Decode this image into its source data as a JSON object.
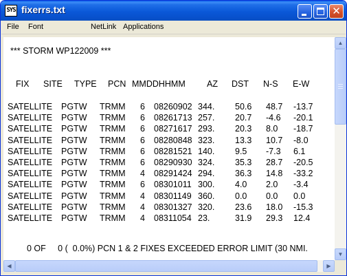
{
  "window": {
    "title": "fixerrs.txt",
    "app_icon_text": "SYS",
    "close_glyph": "✕"
  },
  "menu": [
    "File",
    "Font",
    "NetLink",
    "Applications"
  ],
  "storm_title": "*** STORM WP122009 ***",
  "columns": [
    "FIX",
    "SITE",
    "TYPE",
    "PCN",
    "MMDDHHMM",
    "AZ",
    "DST",
    "N-S",
    "E-W"
  ],
  "rows": [
    [
      "SATELLITE",
      "PGTW",
      "TRMM",
      "6",
      "08260902",
      "344.",
      "50.6",
      "48.7",
      "-13.7"
    ],
    [
      "SATELLITE",
      "PGTW",
      "TRMM",
      "6",
      "08261713",
      "257.",
      "20.7",
      "-4.6",
      "-20.1"
    ],
    [
      "SATELLITE",
      "PGTW",
      "TRMM",
      "6",
      "08271617",
      "293.",
      "20.3",
      "8.0",
      "-18.7"
    ],
    [
      "SATELLITE",
      "PGTW",
      "TRMM",
      "6",
      "08280848",
      "323.",
      "13.3",
      "10.7",
      "-8.0"
    ],
    [
      "SATELLITE",
      "PGTW",
      "TRMM",
      "6",
      "08281521",
      "140.",
      "9.5",
      "-7.3",
      "6.1"
    ],
    [
      "SATELLITE",
      "PGTW",
      "TRMM",
      "6",
      "08290930",
      "324.",
      "35.3",
      "28.7",
      "-20.5"
    ],
    [
      "SATELLITE",
      "PGTW",
      "TRMM",
      "4",
      "08291424",
      "294.",
      "36.3",
      "14.8",
      "-33.2"
    ],
    [
      "SATELLITE",
      "PGTW",
      "TRMM",
      "6",
      "08301011",
      "300.",
      "4.0",
      "2.0",
      "-3.4"
    ],
    [
      "SATELLITE",
      "PGTW",
      "TRMM",
      "4",
      "08301149",
      "360.",
      "0.0",
      "0.0",
      "0.0"
    ],
    [
      "SATELLITE",
      "PGTW",
      "TRMM",
      "4",
      "08301327",
      "320.",
      "23.6",
      "18.0",
      "-15.3"
    ],
    [
      "SATELLITE",
      "PGTW",
      "TRMM",
      "4",
      "08311054",
      "23.",
      "31.9",
      "29.3",
      "12.4"
    ]
  ],
  "footer_line": "0 OF     0 (  0.0%) PCN 1 & 2 FIXES EXCEEDED ERROR LIMIT (30 NMI.",
  "scroll_arrows": {
    "up": "▲",
    "down": "▼",
    "left": "◀",
    "right": "▶"
  }
}
